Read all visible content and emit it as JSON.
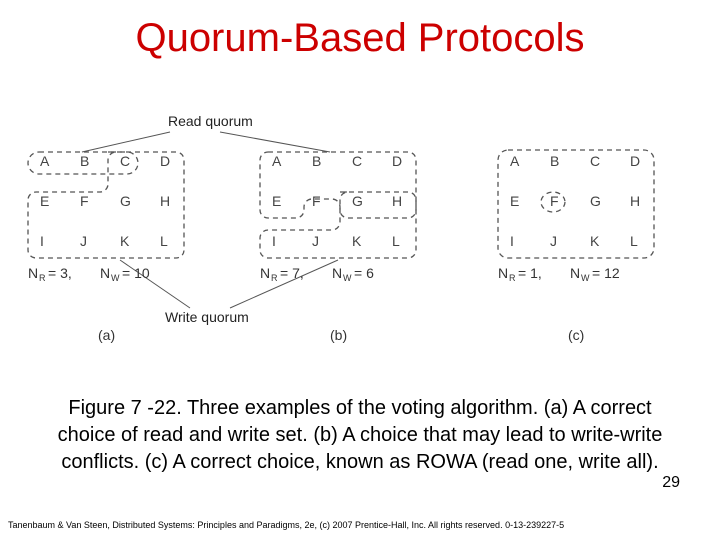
{
  "title": "Quorum-Based Protocols",
  "labels": {
    "read_quorum": "Read quorum",
    "write_quorum": "Write quorum"
  },
  "grid": {
    "rows": [
      [
        "A",
        "B",
        "C",
        "D"
      ],
      [
        "E",
        "F",
        "G",
        "H"
      ],
      [
        "I",
        "J",
        "K",
        "L"
      ]
    ]
  },
  "subfigures": {
    "a": {
      "label": "(a)",
      "nr_text": "N",
      "nr_sub": "R",
      "nr_eq": " = 3,",
      "nw_text": "N",
      "nw_sub": "W",
      "nw_eq": " = 10"
    },
    "b": {
      "label": "(b)",
      "nr_text": "N",
      "nr_sub": "R",
      "nr_eq": " = 7,",
      "nw_text": "N",
      "nw_sub": "W",
      "nw_eq": " = 6"
    },
    "c": {
      "label": "(c)",
      "nr_text": "N",
      "nr_sub": "R",
      "nr_eq": " = 1,",
      "nw_text": "N",
      "nw_sub": "W",
      "nw_eq": " = 12"
    }
  },
  "caption": "Figure 7 -22. Three examples of the voting algorithm. (a) A correct choice of read and write set. (b) A choice that may lead to write-write conflicts. (c) A correct choice, known as ROWA (read one, write all).",
  "page_number": "29",
  "copyright": "Tanenbaum & Van Steen, Distributed Systems: Principles and Paradigms, 2e, (c) 2007 Prentice-Hall, Inc. All rights reserved. 0-13-239227-5",
  "chart_data": [
    {
      "subfigure": "a",
      "NR": 3,
      "NW": 10,
      "nodes": [
        "A",
        "B",
        "C",
        "D",
        "E",
        "F",
        "G",
        "H",
        "I",
        "J",
        "K",
        "L"
      ],
      "read_quorum_nodes": [
        "A",
        "B",
        "C"
      ],
      "note": "correct choice"
    },
    {
      "subfigure": "b",
      "NR": 7,
      "NW": 6,
      "nodes": [
        "A",
        "B",
        "C",
        "D",
        "E",
        "F",
        "G",
        "H",
        "I",
        "J",
        "K",
        "L"
      ],
      "read_quorum_nodes": [
        "A",
        "B",
        "C",
        "D",
        "E",
        "G",
        "H"
      ],
      "note": "may lead to write-write conflicts"
    },
    {
      "subfigure": "c",
      "NR": 1,
      "NW": 12,
      "nodes": [
        "A",
        "B",
        "C",
        "D",
        "E",
        "F",
        "G",
        "H",
        "I",
        "J",
        "K",
        "L"
      ],
      "read_quorum_nodes": [
        "F"
      ],
      "note": "ROWA (read one, write all)"
    }
  ]
}
